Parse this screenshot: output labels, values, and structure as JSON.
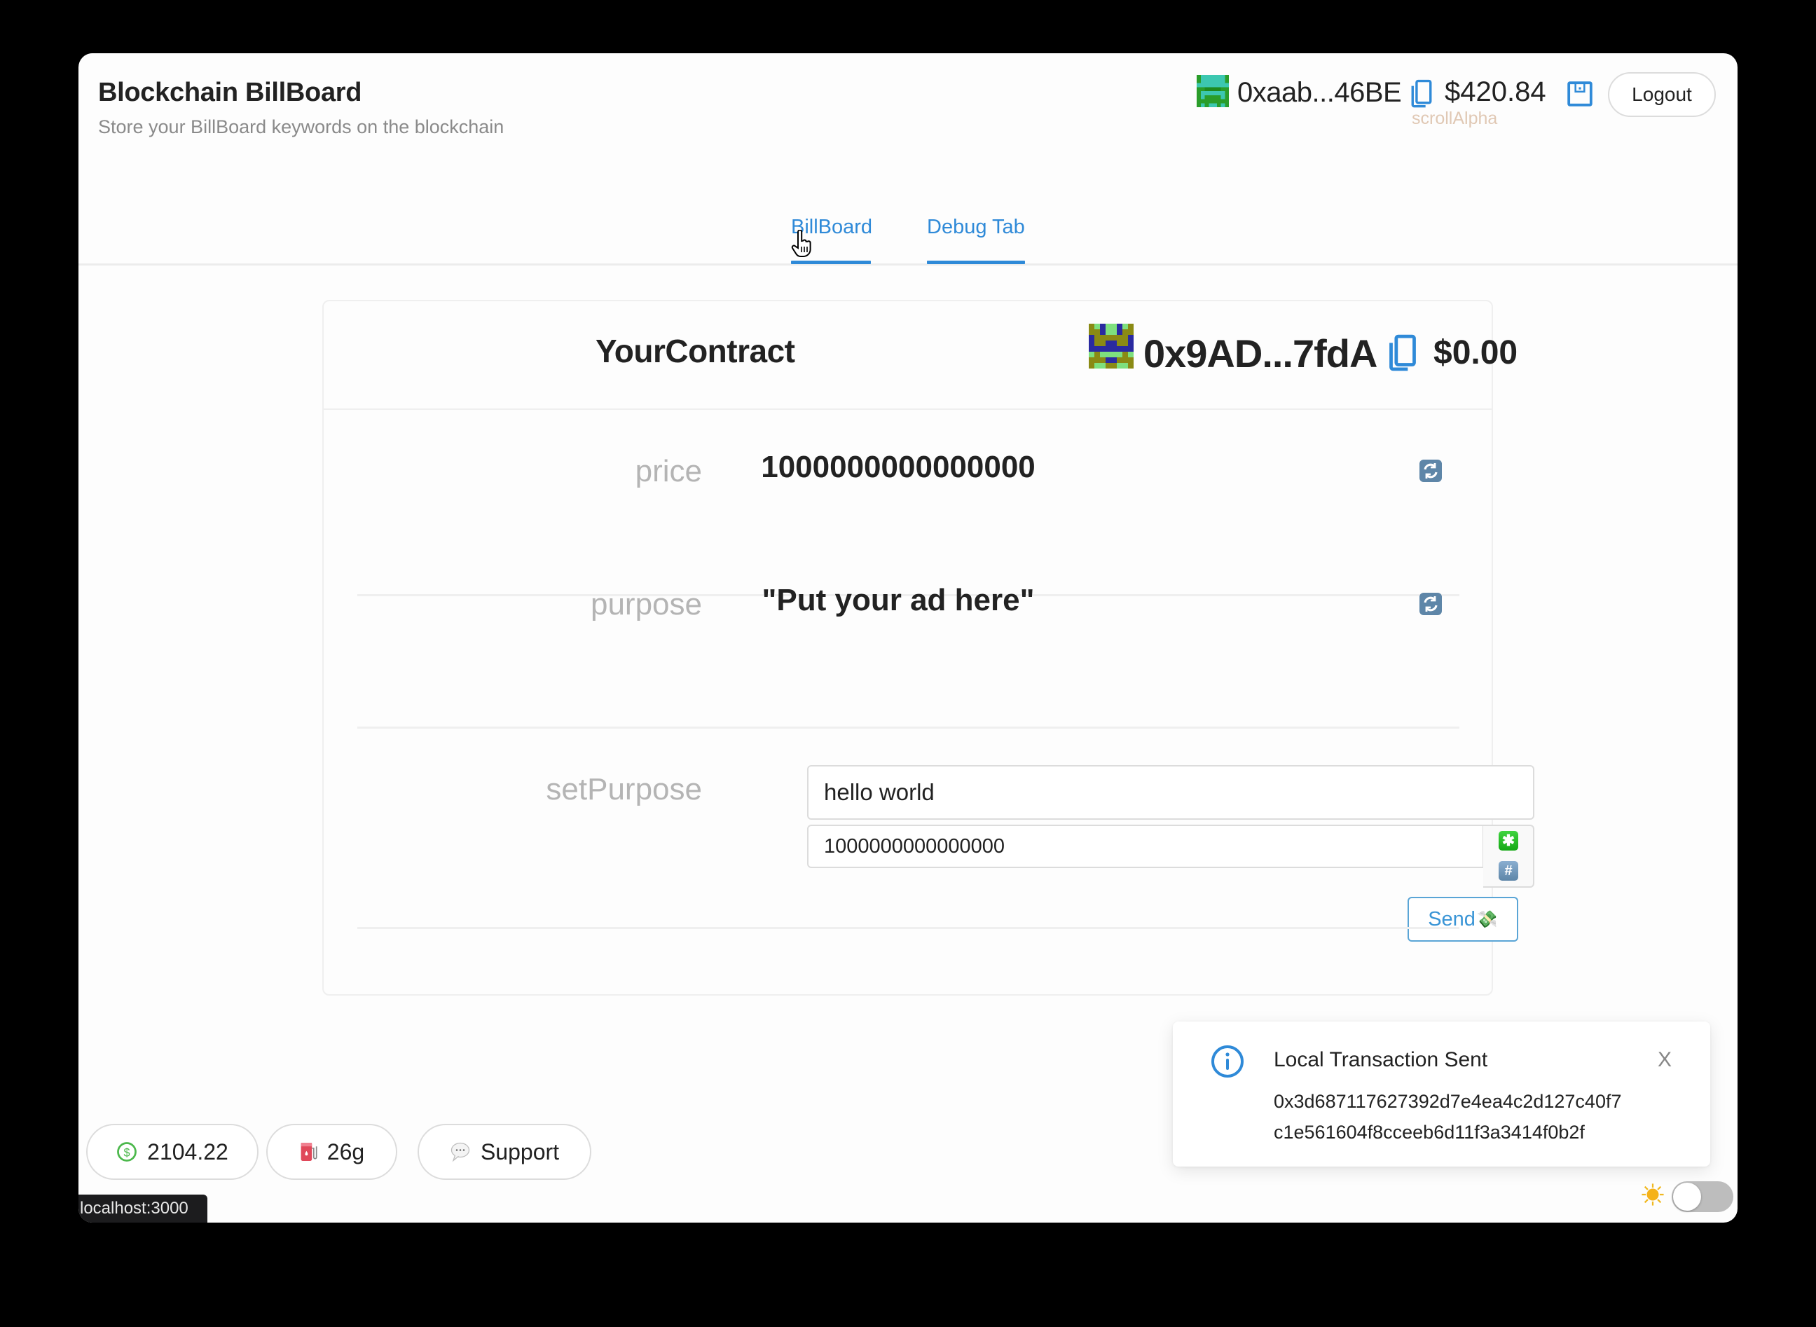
{
  "app": {
    "title": "Blockchain BillBoard",
    "subtitle": "Store your BillBoard keywords on the blockchain"
  },
  "account": {
    "address": "0xaab...46BE",
    "balance": "$420.84",
    "network": "scrollAlpha",
    "logout_label": "Logout",
    "network_color": "#e0c8b4"
  },
  "tabs": [
    {
      "label": "BillBoard",
      "active": true
    },
    {
      "label": "Debug Tab",
      "active": false
    }
  ],
  "contract": {
    "name": "YourContract",
    "address": "0x9AD...7fdA",
    "balance": "$0.00",
    "fields": [
      {
        "label": "price",
        "value": "1000000000000000"
      },
      {
        "label": "purpose",
        "value": "\"Put your ad here\""
      }
    ],
    "write": {
      "label": "setPurpose",
      "text_input_value": "hello world",
      "value_input_value": "1000000000000000",
      "send_label": "Send",
      "send_emoji": "💸",
      "multiply_button": "✱",
      "hash_button": "#"
    }
  },
  "toast": {
    "title": "Local Transaction Sent",
    "hash_line1": "0x3d687117627392d7e4ea4c2d127c40f7",
    "hash_line2": "c1e561604f8cceeb6d11f3a3414f0b2f",
    "close_label": "X"
  },
  "footer": {
    "eth_price": "2104.22",
    "gas_price": "26g",
    "support_label": "Support",
    "status_url": "localhost:3000",
    "dark_mode": false
  },
  "colors": {
    "accent": "#2f8ad8",
    "label_gray": "#b4b4b4",
    "divider": "#efefef"
  }
}
